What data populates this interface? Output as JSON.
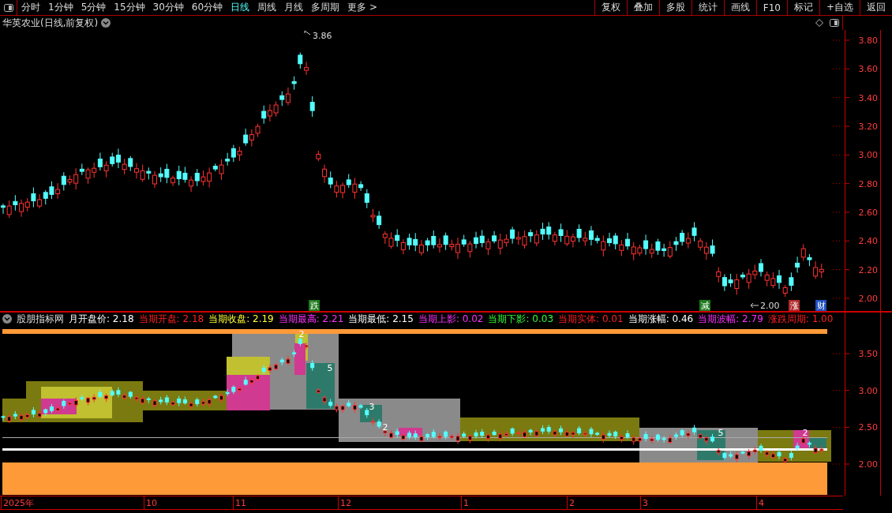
{
  "toolbar": {
    "periods": [
      {
        "label": "分时",
        "selected": false
      },
      {
        "label": "1分钟",
        "selected": false
      },
      {
        "label": "5分钟",
        "selected": false
      },
      {
        "label": "15分钟",
        "selected": false
      },
      {
        "label": "30分钟",
        "selected": false
      },
      {
        "label": "60分钟",
        "selected": false
      },
      {
        "label": "日线",
        "selected": true
      },
      {
        "label": "周线",
        "selected": false
      },
      {
        "label": "月线",
        "selected": false
      },
      {
        "label": "多周期",
        "selected": false
      },
      {
        "label": "更多 >",
        "selected": false
      }
    ],
    "actions": [
      "复权",
      "叠加",
      "多股",
      "统计",
      "画线",
      "F10",
      "标记",
      "+自选",
      "返回"
    ]
  },
  "stock_title": "华英农业(日线,前复权)",
  "price_chart": {
    "y_labels": [
      "3.80",
      "3.60",
      "3.40",
      "3.20",
      "3.00",
      "2.80",
      "2.60",
      "2.40",
      "2.20",
      "2.00"
    ],
    "high_label": "3.86",
    "low_label": "2.00",
    "markers": [
      {
        "text": "跌",
        "color": "#1c7a1c"
      },
      {
        "text": "减",
        "color": "#1c7a1c"
      },
      {
        "text": "涨",
        "color": "#b02a2a"
      },
      {
        "text": "财",
        "color": "#2050c0"
      }
    ]
  },
  "indicator": {
    "name": "股朋指标网",
    "values": [
      {
        "label": "月开盘价:",
        "value": "2.18",
        "color": "#ffffff"
      },
      {
        "label": "当期开盘:",
        "value": "2.18",
        "color": "#ff2020"
      },
      {
        "label": "当期收盘:",
        "value": "2.19",
        "color": "#ffff30"
      },
      {
        "label": "当期最高:",
        "value": "2.21",
        "color": "#ff30ff"
      },
      {
        "label": "当期最低:",
        "value": "2.15",
        "color": "#ffffff"
      },
      {
        "label": "当期上影:",
        "value": "0.02",
        "color": "#ff30ff"
      },
      {
        "label": "当期下影:",
        "value": "0.03",
        "color": "#30ff30"
      },
      {
        "label": "当期实体:",
        "value": "0.01",
        "color": "#ff2020"
      },
      {
        "label": "当期涨幅:",
        "value": "0.46",
        "color": "#ffffff"
      },
      {
        "label": "当期波幅:",
        "value": "2.79",
        "color": "#ff30ff"
      },
      {
        "label": "涨跌周期:",
        "value": "1.00",
        "color": "#ff2020"
      }
    ],
    "y_labels": [
      "3.50",
      "3.00",
      "2.50",
      "2.00"
    ],
    "box_labels": [
      "2",
      "5",
      "3",
      "2",
      "5",
      "2"
    ]
  },
  "time_axis": [
    "2025年",
    "10",
    "11",
    "12",
    "1",
    "2",
    "3",
    "4"
  ]
}
